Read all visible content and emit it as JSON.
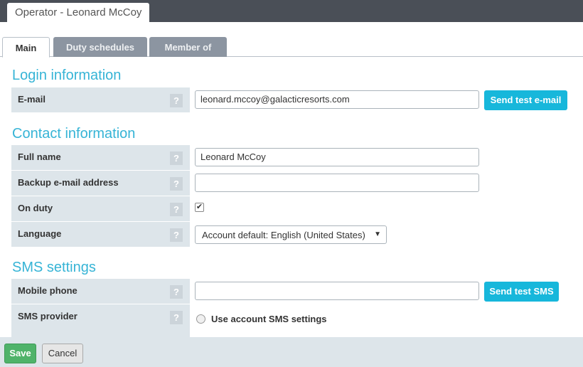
{
  "window": {
    "title": "Operator - Leonard McCoy"
  },
  "tabs": [
    {
      "label": "Main",
      "active": true
    },
    {
      "label": "Duty schedules",
      "active": false
    },
    {
      "label": "Member of",
      "active": false
    }
  ],
  "login": {
    "section_title": "Login information",
    "email": {
      "label": "E-mail",
      "value": "leonard.mccoy@galacticresorts.com",
      "help": "?"
    },
    "send_test_email_label": "Send test e-mail"
  },
  "contact": {
    "section_title": "Contact information",
    "full_name": {
      "label": "Full name",
      "value": "Leonard McCoy",
      "help": "?"
    },
    "backup_email": {
      "label": "Backup e-mail address",
      "value": "",
      "help": "?"
    },
    "on_duty": {
      "label": "On duty",
      "checked": true,
      "check_mark": "✔",
      "help": "?"
    },
    "language": {
      "label": "Language",
      "value": "Account default: English (United States)",
      "help": "?"
    }
  },
  "sms": {
    "section_title": "SMS settings",
    "mobile_phone": {
      "label": "Mobile phone",
      "value": "",
      "help": "?"
    },
    "send_test_sms_label": "Send test SMS",
    "provider": {
      "label": "SMS provider",
      "help": "?",
      "option_label": "Use account SMS settings"
    }
  },
  "footer": {
    "save_label": "Save",
    "cancel_label": "Cancel"
  },
  "colors": {
    "accent": "#36b4d6",
    "teal_button": "#17b7db",
    "save_green": "#4fb36a",
    "label_bg": "#dde5ea"
  }
}
